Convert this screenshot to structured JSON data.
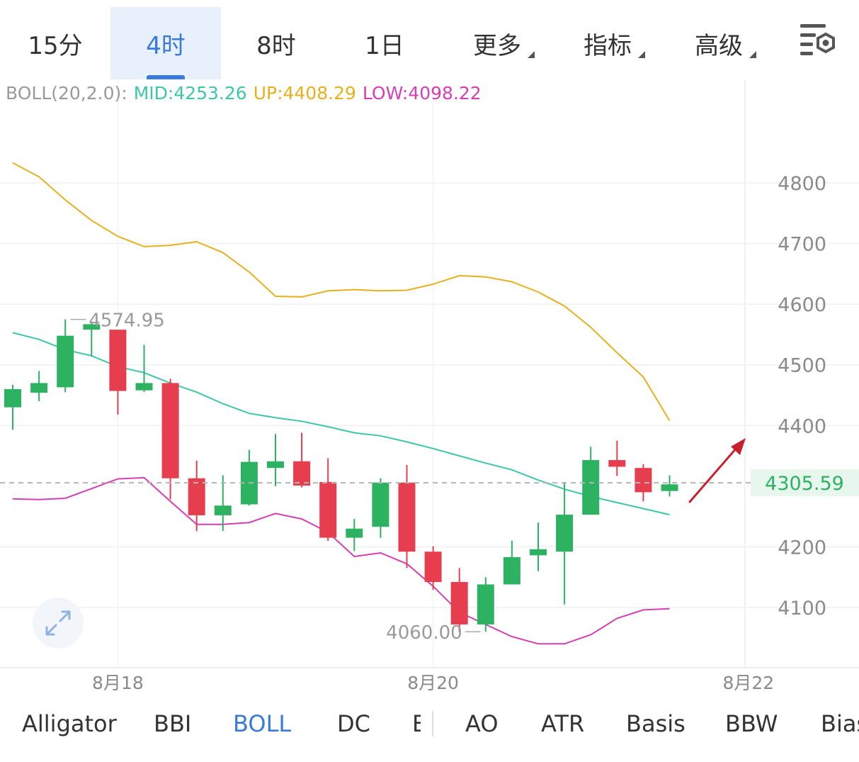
{
  "timeframe_tabs": [
    {
      "label": "15分",
      "active": false,
      "dropdown": false
    },
    {
      "label": "4时",
      "active": true,
      "dropdown": false
    },
    {
      "label": "8时",
      "active": false,
      "dropdown": false
    },
    {
      "label": "1日",
      "active": false,
      "dropdown": false
    },
    {
      "label": "更多",
      "active": false,
      "dropdown": true
    },
    {
      "label": "指标",
      "active": false,
      "dropdown": true
    },
    {
      "label": "高级",
      "active": false,
      "dropdown": true
    }
  ],
  "settings_icon": "chart-settings-icon",
  "boll_legend": {
    "name": "BOLL(20,2.0):",
    "mid": "MID:4253.26",
    "up": "UP:4408.29",
    "low": "LOW:4098.22"
  },
  "colors": {
    "up_candle": "#2db262",
    "down_candle": "#e63e4f",
    "mid_band": "#3cc7a8",
    "upper_band": "#e5b11e",
    "lower_band": "#d63fb4",
    "active_tab": "#3a7bd5",
    "price_label_bg": "#e8f7ee",
    "price_label_text": "#2db262",
    "arrow": "#c8202e"
  },
  "chart_data": {
    "type": "candlestick",
    "y_ticks": [
      4800,
      4700,
      4600,
      4500,
      4400,
      4200,
      4100
    ],
    "ylim": [
      4035,
      4950
    ],
    "current_price": 4305.59,
    "current_price_label": "4305.59",
    "x_ticks": [
      {
        "label": "8月18",
        "index": 4
      },
      {
        "label": "8月20",
        "index": 16
      },
      {
        "label": "8月22",
        "index": 28
      }
    ],
    "high_marker": {
      "label": "4574.95",
      "index": 3,
      "value": 4574.95
    },
    "low_marker": {
      "label": "4060.00",
      "index": 17,
      "value": 4060.0
    },
    "candles": [
      {
        "o": 4430,
        "c": 4460,
        "h": 4467,
        "l": 4393
      },
      {
        "o": 4454,
        "c": 4470,
        "h": 4490,
        "l": 4440
      },
      {
        "o": 4463,
        "c": 4548,
        "h": 4575,
        "l": 4455
      },
      {
        "o": 4558,
        "c": 4567,
        "h": 4570,
        "l": 4514
      },
      {
        "o": 4558,
        "c": 4457,
        "h": 4558,
        "l": 4418
      },
      {
        "o": 4458,
        "c": 4470,
        "h": 4533,
        "l": 4455
      },
      {
        "o": 4470,
        "c": 4313,
        "h": 4477,
        "l": 4278
      },
      {
        "o": 4313,
        "c": 4252,
        "h": 4342,
        "l": 4226
      },
      {
        "o": 4252,
        "c": 4268,
        "h": 4318,
        "l": 4226
      },
      {
        "o": 4270,
        "c": 4340,
        "h": 4360,
        "l": 4268
      },
      {
        "o": 4330,
        "c": 4341,
        "h": 4386,
        "l": 4300
      },
      {
        "o": 4341,
        "c": 4301,
        "h": 4388,
        "l": 4298
      },
      {
        "o": 4307,
        "c": 4215,
        "h": 4346,
        "l": 4210
      },
      {
        "o": 4215,
        "c": 4230,
        "h": 4246,
        "l": 4193
      },
      {
        "o": 4233,
        "c": 4306,
        "h": 4313,
        "l": 4215
      },
      {
        "o": 4306,
        "c": 4192,
        "h": 4335,
        "l": 4165
      },
      {
        "o": 4192,
        "c": 4142,
        "h": 4201,
        "l": 4129
      },
      {
        "o": 4142,
        "c": 4072,
        "h": 4165,
        "l": 4060
      },
      {
        "o": 4072,
        "c": 4138,
        "h": 4150,
        "l": 4060
      },
      {
        "o": 4138,
        "c": 4183,
        "h": 4210,
        "l": 4138
      },
      {
        "o": 4186,
        "c": 4196,
        "h": 4240,
        "l": 4160
      },
      {
        "o": 4192,
        "c": 4253,
        "h": 4307,
        "l": 4105
      },
      {
        "o": 4253,
        "c": 4343,
        "h": 4365,
        "l": 4253
      },
      {
        "o": 4343,
        "c": 4332,
        "h": 4375,
        "l": 4317
      },
      {
        "o": 4330,
        "c": 4290,
        "h": 4336,
        "l": 4275
      },
      {
        "o": 4292,
        "c": 4303,
        "h": 4318,
        "l": 4283
      }
    ],
    "mid_band": [
      4553,
      4542,
      4525,
      4515,
      4497,
      4487,
      4470,
      4455,
      4436,
      4420,
      4413,
      4407,
      4398,
      4388,
      4383,
      4373,
      4362,
      4350,
      4338,
      4327,
      4310,
      4295,
      4283,
      4273,
      4263,
      4253
    ],
    "upper_band": [
      4833,
      4810,
      4772,
      4738,
      4712,
      4695,
      4697,
      4703,
      4685,
      4653,
      4613,
      4612,
      4622,
      4624,
      4622,
      4623,
      4633,
      4647,
      4645,
      4637,
      4620,
      4597,
      4562,
      4520,
      4480,
      4408
    ],
    "lower_band": [
      4279,
      4278,
      4280,
      4296,
      4312,
      4314,
      4275,
      4237,
      4237,
      4240,
      4255,
      4246,
      4224,
      4184,
      4190,
      4172,
      4135,
      4092,
      4072,
      4052,
      4040,
      4040,
      4055,
      4082,
      4096,
      4098
    ]
  },
  "indicator_tabs": [
    {
      "label": "Alligator",
      "active": false
    },
    {
      "label": "BBI",
      "active": false
    },
    {
      "label": "BOLL",
      "active": true
    },
    {
      "label": "DC",
      "active": false
    },
    {
      "label": "E",
      "active": false
    },
    {
      "label": "AO",
      "active": false
    },
    {
      "label": "ATR",
      "active": false
    },
    {
      "label": "Basis",
      "active": false
    },
    {
      "label": "BBW",
      "active": false
    },
    {
      "label": "Bias",
      "active": false
    }
  ],
  "expand_icon": "expand-arrows-icon",
  "trend_arrow_icon": "up-trend-arrow-icon"
}
